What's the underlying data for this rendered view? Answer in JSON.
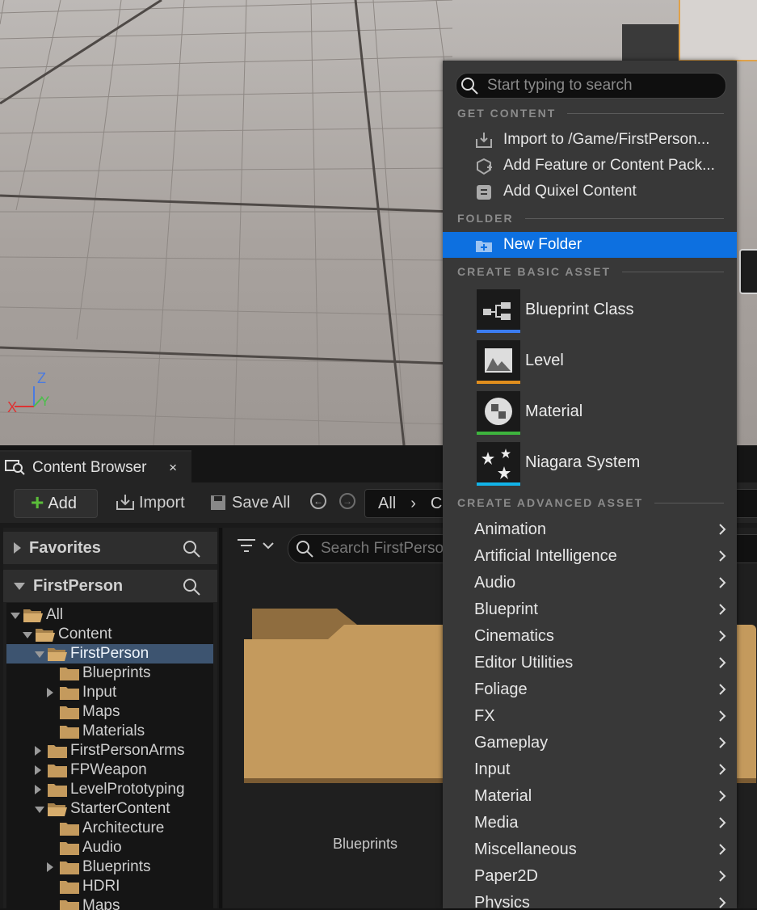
{
  "viewport": {
    "axis_x": "X",
    "axis_y": "Y",
    "axis_z": "Z"
  },
  "tab": {
    "title": "Content Browser",
    "close": "×"
  },
  "toolbar": {
    "add_label": "Add",
    "import_label": "Import",
    "save_all_label": "Save All",
    "path_root": "All",
    "path_next": "C"
  },
  "sources": {
    "favorites_label": "Favorites",
    "project_label": "FirstPerson"
  },
  "tree": [
    {
      "label": "All",
      "depth": 0,
      "expander": "open"
    },
    {
      "label": "Content",
      "depth": 1,
      "expander": "open"
    },
    {
      "label": "FirstPerson",
      "depth": 2,
      "expander": "open",
      "selected": true
    },
    {
      "label": "Blueprints",
      "depth": 3,
      "expander": "none"
    },
    {
      "label": "Input",
      "depth": 3,
      "expander": "closed"
    },
    {
      "label": "Maps",
      "depth": 3,
      "expander": "none"
    },
    {
      "label": "Materials",
      "depth": 3,
      "expander": "none"
    },
    {
      "label": "FirstPersonArms",
      "depth": 2,
      "expander": "closed"
    },
    {
      "label": "FPWeapon",
      "depth": 2,
      "expander": "closed"
    },
    {
      "label": "LevelPrototyping",
      "depth": 2,
      "expander": "closed"
    },
    {
      "label": "StarterContent",
      "depth": 2,
      "expander": "open"
    },
    {
      "label": "Architecture",
      "depth": 3,
      "expander": "none"
    },
    {
      "label": "Audio",
      "depth": 3,
      "expander": "none"
    },
    {
      "label": "Blueprints",
      "depth": 3,
      "expander": "closed"
    },
    {
      "label": "HDRI",
      "depth": 3,
      "expander": "none"
    },
    {
      "label": "Maps",
      "depth": 3,
      "expander": "none"
    }
  ],
  "assets": {
    "search_placeholder": "Search FirstPerson",
    "folder_label": "Blueprints"
  },
  "menu": {
    "search_placeholder": "Start typing to search",
    "sections": {
      "get_content": "GET CONTENT",
      "folder": "FOLDER",
      "basic": "CREATE BASIC ASSET",
      "advanced": "CREATE ADVANCED ASSET"
    },
    "get_content_items": [
      {
        "label": "Import to /Game/FirstPerson...",
        "icon": "import-icon"
      },
      {
        "label": "Add Feature or Content Pack...",
        "icon": "feature-pack-icon"
      },
      {
        "label": "Add Quixel Content",
        "icon": "quixel-icon"
      }
    ],
    "folder_item": {
      "label": "New Folder",
      "icon": "new-folder-icon"
    },
    "basic_assets": [
      {
        "label": "Blueprint Class",
        "color": "#3b7cf0",
        "icon": "blueprint-class-icon"
      },
      {
        "label": "Level",
        "color": "#e08e1e",
        "icon": "level-icon"
      },
      {
        "label": "Material",
        "color": "#3eb43e",
        "icon": "material-icon"
      },
      {
        "label": "Niagara System",
        "color": "#12b3e8",
        "icon": "niagara-icon"
      }
    ],
    "advanced_items": [
      "Animation",
      "Artificial Intelligence",
      "Audio",
      "Blueprint",
      "Cinematics",
      "Editor Utilities",
      "Foliage",
      "FX",
      "Gameplay",
      "Input",
      "Material",
      "Media",
      "Miscellaneous",
      "Paper2D",
      "Physics"
    ]
  },
  "colors": {
    "highlight": "#0d70e0",
    "tree_selected": "#3d5470",
    "folder": "#c49a5d",
    "add_plus": "#5bbd3a"
  }
}
